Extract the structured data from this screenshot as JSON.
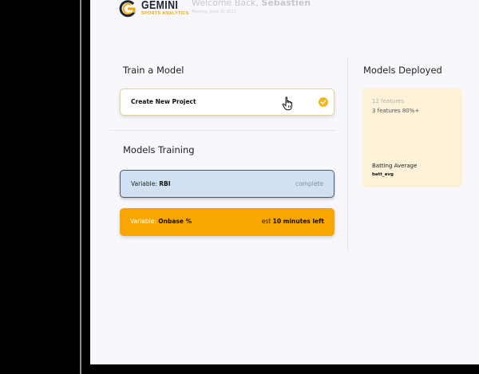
{
  "brand": {
    "name": "GEMINI",
    "tagline": "SPORTS ANALYTICS",
    "colors": {
      "primary": "#f2a900",
      "dark": "#1b2230"
    }
  },
  "header": {
    "welcome_prefix": "Welcome Back, ",
    "user_name": "Sebastien",
    "date": "Monday, June 20 2021"
  },
  "train": {
    "title": "Train a Model",
    "create_label": "Create New Project",
    "check_icon": "check-circle-icon",
    "cursor_icon": "hand-pointer-icon"
  },
  "training": {
    "title": "Models Training",
    "items": [
      {
        "key": "Variable: ",
        "value": "RBI",
        "status": "complete",
        "status_prefix": "",
        "status_bold": ""
      },
      {
        "key": "Variable: ",
        "value": "Onbase %",
        "status": "",
        "status_prefix": "est ",
        "status_bold": "10 minutes left"
      }
    ],
    "colors": {
      "complete": "#cfe1f3",
      "running": "#f9a602"
    }
  },
  "deployed": {
    "title": "Models Deployed",
    "features_count": "12 features",
    "features_detail": "3 features 80%+",
    "model_name": "Batting Average",
    "model_id": "batt_avg",
    "color": "#fdf1d8"
  }
}
